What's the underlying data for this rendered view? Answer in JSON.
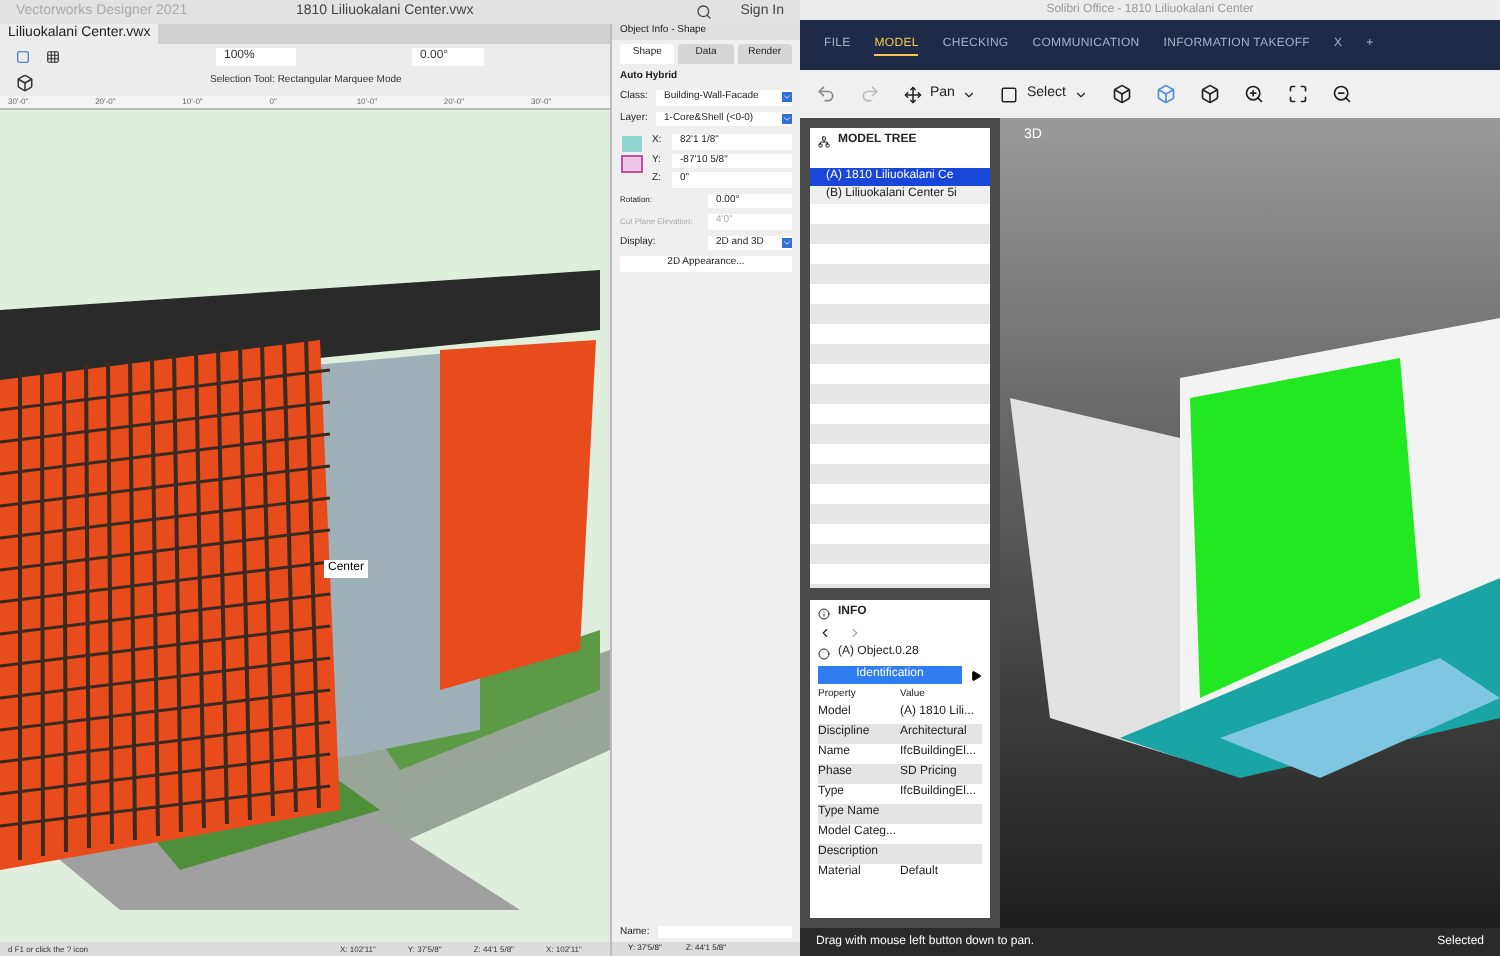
{
  "left_app": {
    "app_title": "Vectorworks Designer 2021",
    "file_title": "1810 Liliuokalani Center.vwx",
    "sign_in": "Sign In",
    "doc_tab": "Liliuokalani Center.vwx",
    "toolbar": {
      "zoom": "100%",
      "angle": "0.00°",
      "mode": "Selection Tool: Rectangular Marquee Mode"
    },
    "ruler": [
      "30'-0\"",
      "20'-0\"",
      "10'-0\"",
      "0\"",
      "10'-0\"",
      "20'-0\"",
      "30'-0\""
    ],
    "viewport_label": "Center",
    "status_bar": {
      "hint": "d F1 or click the ? icon",
      "coords": [
        "X: 102'11\"",
        "Y: 37'5/8\"",
        "Z: 44'1 5/8\"",
        "X: 102'11\""
      ]
    },
    "object_info": {
      "title": "Object Info - Shape",
      "tabs": [
        {
          "label": "Shape",
          "selected": true
        },
        {
          "label": "Data",
          "selected": false
        },
        {
          "label": "Render",
          "selected": false
        }
      ],
      "type": "Auto Hybrid",
      "dropdowns": [
        {
          "label": "Class:",
          "value": "Building-Wall-Facade"
        },
        {
          "label": "Layer:",
          "value": "1-Core&Shell (<0-0)"
        }
      ],
      "coords": [
        {
          "label": "X:",
          "value": "82'1 1/8\""
        },
        {
          "label": "Y:",
          "value": "-87'10 5/8\""
        },
        {
          "label": "Z:",
          "value": "0\""
        }
      ],
      "fields": [
        {
          "label": "Rotation:",
          "value": "0.00°",
          "disabled": false
        },
        {
          "label": "Cut Plane Elevation:",
          "value": "4'0\"",
          "disabled": true
        }
      ],
      "display": {
        "label": "Display:",
        "value": "2D and 3D"
      },
      "button": "2D Appearance...",
      "name_label": "Name:",
      "coords_bar": [
        "Y: 37'5/8\"",
        "Z: 44'1 5/8\""
      ]
    }
  },
  "right_app": {
    "title": "Solibri Office - 1810 Liliuokalani Center",
    "menu": [
      {
        "label": "FILE",
        "selected": false
      },
      {
        "label": "MODEL",
        "selected": true
      },
      {
        "label": "CHECKING",
        "selected": false
      },
      {
        "label": "COMMUNICATION",
        "selected": false
      },
      {
        "label": "INFORMATION TAKEOFF",
        "selected": false
      },
      {
        "label": "X",
        "selected": false
      },
      {
        "label": "+",
        "selected": false
      }
    ],
    "toolbar": {
      "pan": "Pan",
      "select": "Select"
    },
    "model_tree": {
      "title": "MODEL TREE",
      "rows": [
        {
          "label": "(A) 1810 Liliuokalani Ce",
          "selected": true
        },
        {
          "label": "(B) Liliuokalani Center 5i",
          "selected": false
        }
      ]
    },
    "info": {
      "title": "INFO",
      "object": "(A) Object.0.28",
      "tab": "Identification",
      "columns": [
        "Property",
        "Value"
      ],
      "rows": [
        [
          "Model",
          "(A) 1810 Lili..."
        ],
        [
          "Discipline",
          "Architectural"
        ],
        [
          "Name",
          "IfcBuildingEl..."
        ],
        [
          "Phase",
          "SD Pricing"
        ],
        [
          "Type",
          "IfcBuildingEl..."
        ],
        [
          "Type Name",
          ""
        ],
        [
          "Model Categ...",
          ""
        ],
        [
          "Description",
          ""
        ],
        [
          "Material",
          "Default"
        ]
      ]
    },
    "view_label": "3D",
    "status_bar": {
      "hint": "Drag with mouse left button down to pan.",
      "right": "Selected"
    }
  }
}
